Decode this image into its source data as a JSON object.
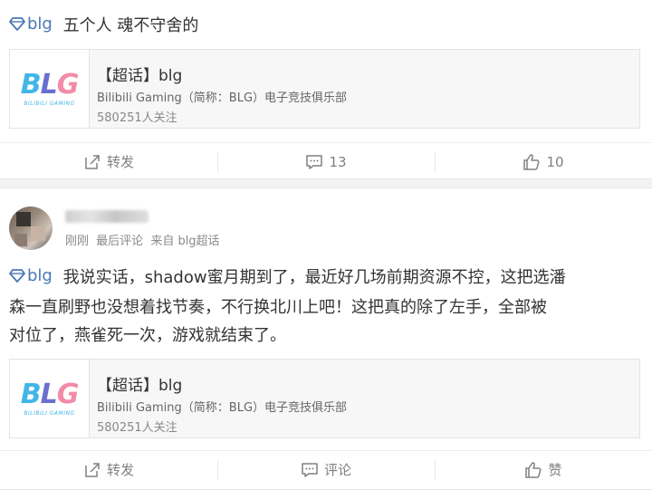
{
  "colors": {
    "accent": "#eb7350",
    "topic_blue": "#4a78b5",
    "icon_gray": "#808080"
  },
  "posts": [
    {
      "topic_icon": "diamond-icon",
      "topic": "blg",
      "text_lines": [
        "五个人 魂不守舍的"
      ],
      "share": {
        "logo": "BLG",
        "logo_sub": "BILIBILI GAMING",
        "title": "【超话】blg",
        "description": "Bilibili Gaming（简称：BLG）电子竞技俱乐部",
        "followers": "580251人关注"
      },
      "actions": {
        "repost": "转发",
        "comment": "13",
        "like": "10"
      }
    },
    {
      "meta": {
        "time": "刚刚",
        "last_comment": "最后评论",
        "source": "来自 blg超话"
      },
      "topic_icon": "diamond-icon",
      "topic": "blg",
      "text_lines": [
        "我说实话，shadow蜜月期到了，最近好几场前期资源不控，这把选潘",
        "森一直刷野也没想着找节奏，不行换北川上吧！这把真的除了左手，全部被",
        "对位了，燕雀死一次，游戏就结束了。"
      ],
      "share": {
        "logo": "BLG",
        "logo_sub": "BILIBILI GAMING",
        "title": "【超话】blg",
        "description": "Bilibili Gaming（简称：BLG）电子竞技俱乐部",
        "followers": "580251人关注"
      },
      "actions": {
        "repost": "转发",
        "comment": "评论",
        "like": "赞"
      }
    }
  ]
}
